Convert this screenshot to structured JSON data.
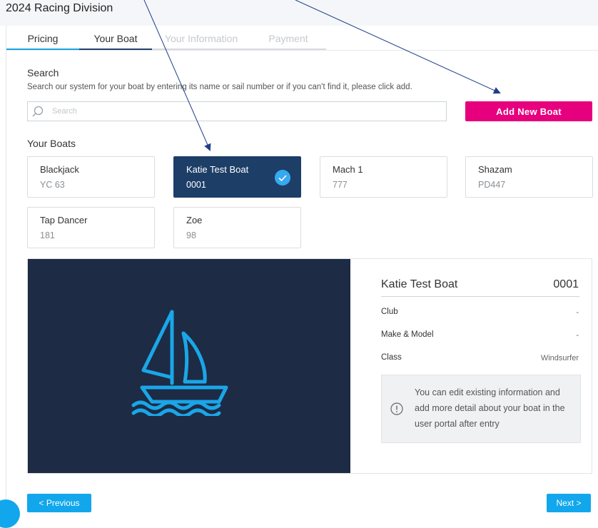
{
  "page": {
    "title": "2024 Racing Division"
  },
  "tabs": [
    {
      "label": "Pricing",
      "state": "done"
    },
    {
      "label": "Your Boat",
      "state": "active"
    },
    {
      "label": "Your Information",
      "state": "future"
    },
    {
      "label": "Payment",
      "state": "future"
    }
  ],
  "search": {
    "title": "Search",
    "help": "Search our system for your boat by entering its name or sail number or if you can't find it, please click add.",
    "placeholder": "Search",
    "icon": "search-icon"
  },
  "add_button": {
    "label": "Add New Boat"
  },
  "boats": {
    "heading": "Your Boats",
    "items": [
      {
        "name": "Blackjack",
        "number": "YC 63",
        "selected": false
      },
      {
        "name": "Katie Test Boat",
        "number": "0001",
        "selected": true
      },
      {
        "name": "Mach 1",
        "number": "777",
        "selected": false
      },
      {
        "name": "Shazam",
        "number": "PD447",
        "selected": false
      },
      {
        "name": "Tap Dancer",
        "number": "181",
        "selected": false
      },
      {
        "name": "Zoe",
        "number": "98",
        "selected": false
      }
    ]
  },
  "detail": {
    "name": "Katie Test Boat",
    "number": "0001",
    "fields": [
      {
        "label": "Club",
        "value": "-"
      },
      {
        "label": "Make & Model",
        "value": "-"
      },
      {
        "label": "Class",
        "value": "Windsurfer"
      }
    ],
    "notice": "You can edit existing information and add more detail about your boat in the user portal after entry"
  },
  "nav": {
    "previous": "< Previous",
    "next": "Next >"
  },
  "colors": {
    "accent_pink": "#e6007e",
    "accent_blue": "#12a7ec",
    "navy": "#1d3e67",
    "image_bg": "#1d2b44",
    "annotation_arrow": "#1f3f8a"
  }
}
